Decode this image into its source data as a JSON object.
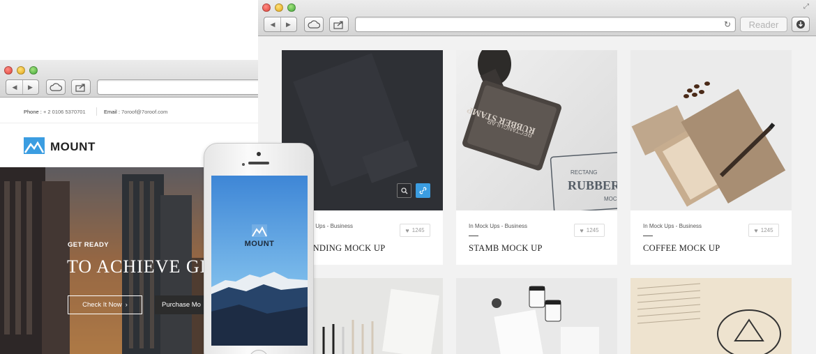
{
  "back_browser": {
    "reader_label": "Reader",
    "portfolio": [
      {
        "category": "In Mock Ups - Business",
        "title": "BRANDING MOCK UP",
        "likes": "1245"
      },
      {
        "category": "In Mock Ups - Business",
        "title": "STAMB MOCK UP",
        "likes": "1245"
      },
      {
        "category": "In Mock Ups - Business",
        "title": "COFFEE MOCK UP",
        "likes": "1245"
      }
    ],
    "stamp_text": {
      "line_top": "RECTANGULAR",
      "line_main": "RUBBER STAMP",
      "line_bottom": "MOCKUP",
      "print_main": "RUBBER",
      "print_top": "RECTANG",
      "print_bottom": "MOC"
    }
  },
  "front_site": {
    "phone_label": "Phone :",
    "phone_value": "+ 2 0106 5370701",
    "email_label": "Email :",
    "email_value": "7oroof@7oroof.com",
    "brand": "MOUNT",
    "hero_kicker": "GET READY",
    "hero_title": "TO ACHIEVE GL",
    "btn_primary": "Check It Now",
    "btn_secondary": "Purchase Mo"
  },
  "phone_app": {
    "brand": "MOUNT"
  },
  "colors": {
    "accent": "#3b9de1",
    "dark_card": "#2e3035",
    "hero_tint": "#e8a25d"
  }
}
